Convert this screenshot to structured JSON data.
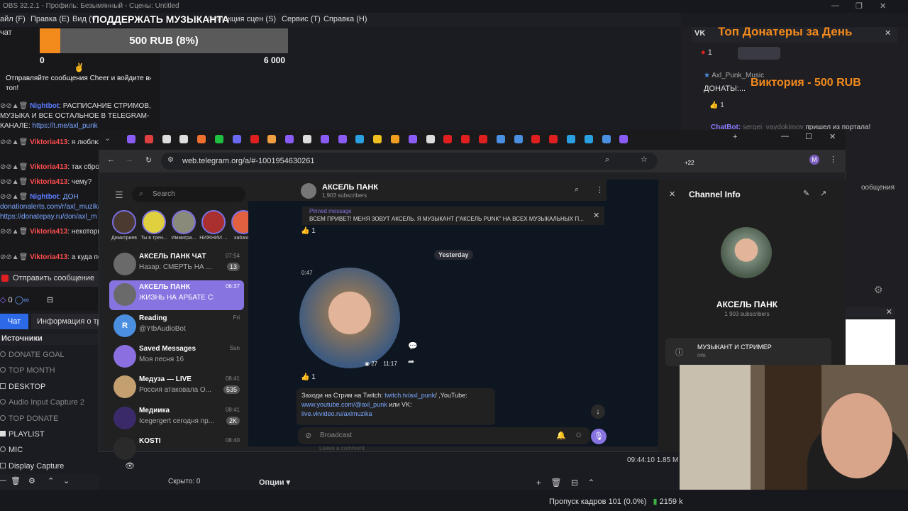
{
  "obs": {
    "title": "OBS 32.2.1 - Профиль: Безымянный - Сцены: Untitled",
    "menu": [
      "айт",
      "Правка (E)",
      "Вид (V)",
      "Коллекция сцен (S)",
      "Сервис (T)",
      "Справка (H)"
    ],
    "menu_file": "айл (F)",
    "donate_title": "ПОДДЕРЖАТЬ МУЗЫКАНТА",
    "goal_text": "500 RUB (8%)",
    "goal_fraction": 0.083,
    "goal_min": "0",
    "goal_max": "6 000",
    "chat_label": "чат",
    "cheer_text": "Отправляйте сообщения Cheer и войдите в топ!",
    "chat_lines": [
      {
        "nick": "Nightbot",
        "color": "#5c7cff",
        "text": ": РАСПИСАНИЕ СТРИМОВ, МУЗЫКА И ВСЕ ОСТАЛЬНОЕ В TELEGRAM-КАНАЛЕ: ",
        "link": "https://t.me/axl_punk"
      },
      {
        "nick": "Viktoria413",
        "color": "#ff4d4d",
        "text": ": я люблю истории",
        "link": ""
      },
      {
        "nick": "Viktoria413",
        "color": "#ff4d4d",
        "text": ": так сбрось",
        "link": ""
      },
      {
        "nick": "Viktoria413",
        "color": "#ff4d4d",
        "text": ": чему?",
        "link": ""
      },
      {
        "nick": "Nightbot",
        "color": "#5c7cff",
        "text": ": ДОН donationalerts.com/r/axl_muzika https://donatepay.ru/don/axl_m",
        "link": ""
      },
      {
        "nick": "Viktoria413",
        "color": "#ff4d4d",
        "text": ": некоторые зонят",
        "link": ""
      },
      {
        "nick": "Viktoria413",
        "color": "#ff4d4d",
        "text": ": а куда по",
        "link": ""
      }
    ],
    "send_message": "Отправить сообщение",
    "points": "0",
    "tab_chat": "Чат",
    "tab_info": "Информация о трансляции",
    "sources_header": "Источники",
    "sources": [
      {
        "name": "DONATE GOAL",
        "dim": true
      },
      {
        "name": "TOP MONTH",
        "dim": true
      },
      {
        "name": "DESKTOP",
        "dim": false
      },
      {
        "name": "Audio Input Capture 2",
        "dim": true
      },
      {
        "name": "TOP DONATE",
        "dim": true
      },
      {
        "name": "PLAYLIST",
        "dim": false
      },
      {
        "name": "MIC",
        "dim": false
      },
      {
        "name": "Display Capture",
        "dim": false
      }
    ],
    "hidden_label": "Скрыто: 0",
    "options_label": "Опции",
    "status_frames": "Пропуск кадров 101 (0.0%)",
    "status_kbps": "2159 k",
    "clock": "09:44:10",
    "clock_extra": "1.85 M"
  },
  "vk_panel": {
    "vk_label": "VK",
    "top_donaters": "Топ Донатеры за День",
    "count": "1",
    "channel_name": "Axl_Punk_Music",
    "donations_label": "ДОНАТЫ:...",
    "top_donation": "Виктория - 500 RUB",
    "like_count": "1",
    "chatbot_nick": "ChatBot:",
    "chatbot_user": "sergei_vaydokimov",
    "chatbot_text": "пришел из портала!",
    "messages_label": "ообщения"
  },
  "browser": {
    "url": "web.telegram.org/a/#-1001954630261",
    "extensions_count": "+22",
    "profile_letter": "M"
  },
  "telegram": {
    "search_placeholder": "Search",
    "stories": [
      "Димитриев",
      "Ты в трен...",
      "Иммигра...",
      "НИЖНИЙ ...",
      "кабачко"
    ],
    "chats": [
      {
        "name": "АКСЕЛЬ ПАНК ЧАТ",
        "preview": "Назар: СМЕРТЬ НА ...",
        "time": "07:54",
        "badge": "13",
        "active": false,
        "color": "#6a6a6a"
      },
      {
        "name": "АКСЕЛЬ ПАНК",
        "preview": "ЖИЗНЬ НА АРБАТЕ СЕКС...",
        "time": "06:37",
        "badge": "",
        "active": true,
        "color": "#6a6a6a"
      },
      {
        "name": "Reading",
        "preview": "@YtbAudioBot",
        "time": "Fri",
        "badge": "",
        "active": false,
        "color": "#4a8fe0",
        "letter": "R"
      },
      {
        "name": "Saved Messages",
        "preview": "Моя песня 16",
        "time": "Sun",
        "badge": "",
        "active": false,
        "color": "#8b6fe0"
      },
      {
        "name": "Медуза — LIVE",
        "preview": "Россия атаковала О...",
        "time": "08:41",
        "badge": "535",
        "active": false,
        "color": "#c4a070"
      },
      {
        "name": "Медиика",
        "preview": "Icegergert сегодня пр...",
        "time": "08:41",
        "badge": "2K",
        "active": false,
        "color": "#3a2a6a"
      },
      {
        "name": "KOSTI",
        "preview": "",
        "time": "08:40",
        "badge": "",
        "active": false,
        "color": "#2a2a2a"
      }
    ],
    "channel_title": "АКСЕЛЬ ПАНК",
    "channel_subs": "1,903 subscribers",
    "pinned_label": "Pinned message",
    "pinned_text": "ВСЕМ ПРИВЕТ! МЕНЯ ЗОВУТ АКСЕЛЬ. Я МУЗЫКАНТ (\"АКСЕЛЬ PUNK\" НА ВСЕХ МУЗЫКАЛЬНЫХ П...",
    "reaction_count": "1",
    "date_sep": "Yesterday",
    "video_duration": "0:47",
    "video_views": "27",
    "video_time": "11:17",
    "msg_text": "Заходи на Стрим на Twitch: ",
    "msg_link1": "twitch.tv/axl_punk",
    "msg_mid": "/ ,YouTube:",
    "msg_link2": "www.youtube.com/@axl_punk",
    "msg_mid2": " или VK:",
    "msg_link3": "live.vkvideo.ru/axlmuzika",
    "broadcast_placeholder": "Broadcast",
    "info_title": "Channel Info",
    "info_name": "АКСЕЛЬ ПАНК",
    "info_subs": "1 903 subscribers",
    "info_desc": "МУЗЫКАНТ И СТРИМЕР",
    "info_desc_label": "Info",
    "leave_label": "Leave a comment"
  },
  "colors": {
    "accent": "#8774e1",
    "orange": "#f28a1c",
    "blue_tab": "#2c6ae8"
  }
}
